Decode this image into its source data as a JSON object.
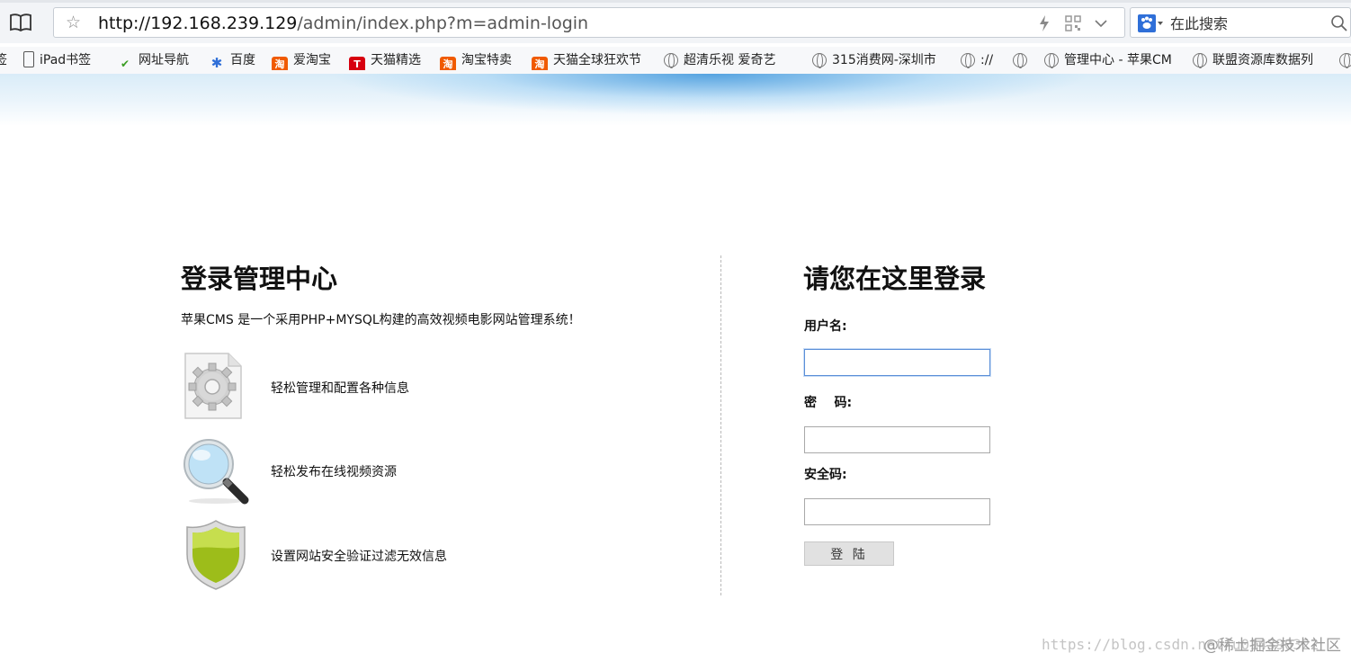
{
  "browser": {
    "url_host": "http://192.168.239.129",
    "url_path": "/admin/index.php?m=admin-login",
    "search_placeholder": "在此搜索"
  },
  "bookmarks": [
    {
      "label": "签",
      "icon": "bookmark-partial-icon"
    },
    {
      "label": "iPad书签",
      "icon": "ipad-icon"
    },
    {
      "label": "网址导航",
      "icon": "hao123-icon"
    },
    {
      "label": "百度",
      "icon": "baidu-paw-icon"
    },
    {
      "label": "爱淘宝",
      "icon": "taobao-icon"
    },
    {
      "label": "天猫精选",
      "icon": "tmall-icon"
    },
    {
      "label": "淘宝特卖",
      "icon": "taobao-icon"
    },
    {
      "label": "天猫全球狂欢节",
      "icon": "taobao-icon"
    },
    {
      "label": "超清乐视 爱奇艺 ",
      "icon": "globe-icon"
    },
    {
      "label": "315消费网-深圳市",
      "icon": "globe-icon"
    },
    {
      "label": "://",
      "icon": "globe-icon"
    },
    {
      "label": "",
      "icon": "globe-icon"
    },
    {
      "label": "管理中心 - 苹果CM",
      "icon": "globe-icon"
    },
    {
      "label": "联盟资源库数据列",
      "icon": "globe-icon"
    },
    {
      "label": "",
      "icon": "globe-icon"
    }
  ],
  "left": {
    "title": "登录管理中心",
    "description": "苹果CMS 是一个采用PHP+MYSQL构建的高效视频电影网站管理系统！",
    "features": [
      {
        "text": "轻松管理和配置各种信息",
        "icon": "gear-document-icon"
      },
      {
        "text": "轻松发布在线视频资源",
        "icon": "magnifier-icon"
      },
      {
        "text": "设置网站安全验证过滤无效信息",
        "icon": "shield-icon"
      }
    ]
  },
  "form": {
    "title": "请您在这里登录",
    "username_label": "用户名:",
    "password_label": "密    码:",
    "captcha_label": "安全码:",
    "username_value": "",
    "password_value": "",
    "captcha_value": "",
    "submit_label": "登 陆"
  },
  "watermark": {
    "url_text": "https://blog.csdn.net/u014390322",
    "community_text": "@稀土掘金技术社区"
  },
  "colors": {
    "banner_blue": "#3e96dc",
    "focus_border": "#5b8fd8",
    "button_bg": "#e1e1e1"
  }
}
